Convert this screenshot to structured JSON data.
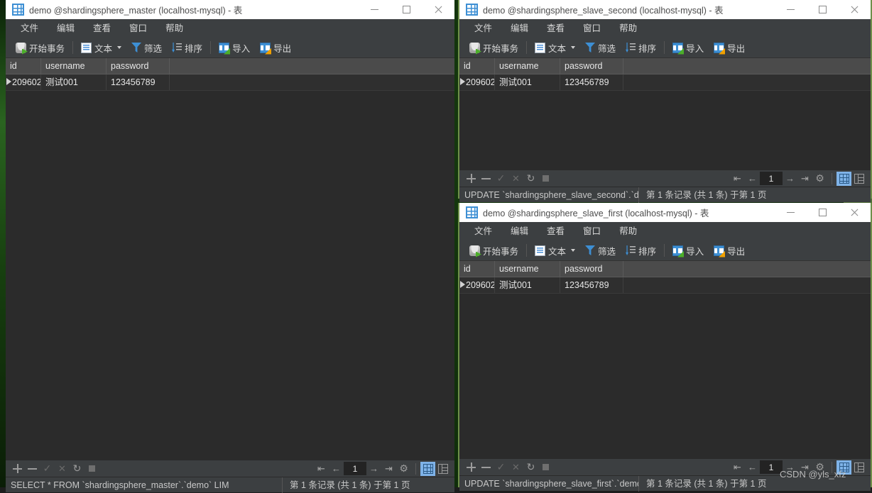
{
  "windows": [
    {
      "id": "master",
      "title": "demo @shardingsphere_master (localhost-mysql) - 表",
      "menu": [
        "文件",
        "编辑",
        "查看",
        "窗口",
        "帮助"
      ],
      "toolbar": {
        "transaction": "开始事务",
        "text": "文本",
        "filter": "筛选",
        "sort": "排序",
        "import": "导入",
        "export": "导出"
      },
      "grid": {
        "columns": [
          "id",
          "username",
          "password"
        ],
        "rows": [
          [
            "209602",
            "测试001",
            "123456789"
          ]
        ]
      },
      "nav": {
        "page": "1"
      },
      "status": {
        "sql": "SELECT * FROM `shardingsphere_master`.`demo` LIM",
        "records": "第 1 条记录 (共 1 条) 于第 1 页"
      }
    },
    {
      "id": "slave_second",
      "title": "demo @shardingsphere_slave_second (localhost-mysql) - 表",
      "menu": [
        "文件",
        "编辑",
        "查看",
        "窗口",
        "帮助"
      ],
      "toolbar": {
        "transaction": "开始事务",
        "text": "文本",
        "filter": "筛选",
        "sort": "排序",
        "import": "导入",
        "export": "导出"
      },
      "grid": {
        "columns": [
          "id",
          "username",
          "password"
        ],
        "rows": [
          [
            "209602",
            "测试001",
            "123456789"
          ]
        ]
      },
      "nav": {
        "page": "1"
      },
      "status": {
        "sql": "UPDATE `shardingsphere_slave_second`.`d",
        "records": "第 1 条记录 (共 1 条) 于第 1 页"
      }
    },
    {
      "id": "slave_first",
      "title": "demo @shardingsphere_slave_first (localhost-mysql) - 表",
      "menu": [
        "文件",
        "编辑",
        "查看",
        "窗口",
        "帮助"
      ],
      "toolbar": {
        "transaction": "开始事务",
        "text": "文本",
        "filter": "筛选",
        "sort": "排序",
        "import": "导入",
        "export": "导出"
      },
      "grid": {
        "columns": [
          "id",
          "username",
          "password"
        ],
        "rows": [
          [
            "209602",
            "测试001",
            "123456789"
          ]
        ]
      },
      "nav": {
        "page": "1"
      },
      "status": {
        "sql": "UPDATE `shardingsphere_slave_first`.`demo",
        "records": "第 1 条记录 (共 1 条) 于第 1 页"
      }
    }
  ],
  "watermark": "CSDN @yls_xfz",
  "colors": {
    "accent": "#3d8fd4",
    "window_bg": "#2b2b2b",
    "chrome": "#3c3f41",
    "header_row": "#4b4b4b",
    "border_green": "#6f8f4a"
  }
}
